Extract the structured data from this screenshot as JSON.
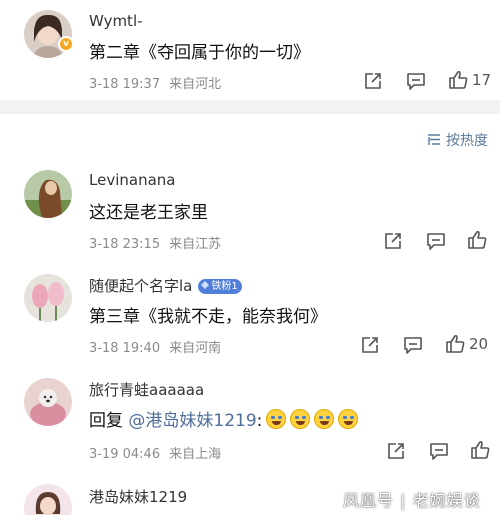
{
  "top_comment": {
    "username": "Wymtl-",
    "text": "第二章《夺回属于你的一切》",
    "date": "3-18 19:37",
    "location": "来自河北",
    "likes": "17",
    "verified_badge": "v"
  },
  "sort": {
    "icon": "sort-icon",
    "label": "按热度"
  },
  "comments": [
    {
      "username": "Levinanana",
      "text": "这还是老王家里",
      "date": "3-18 23:15",
      "location": "来自江苏",
      "likes": ""
    },
    {
      "username": "随便起个名字la",
      "fan_badge": "铁粉1",
      "text": "第三章《我就不走，能奈我何》",
      "date": "3-18 19:40",
      "location": "来自河南",
      "likes": "20"
    },
    {
      "username": "旅行青蛙aaaaaa",
      "reply_prefix": "回复",
      "mention": "@港岛妹妹1219",
      "text_suffix": ":",
      "date": "3-19 04:46",
      "location": "来自上海",
      "likes": ""
    },
    {
      "username": "港岛妹妹1219"
    }
  ],
  "watermark": "凤凰号 | 老婉娱谈",
  "colors": {
    "accent_link": "#4e6e9a",
    "meta_gray": "#8a8a8a",
    "divider": "#f2f2f2",
    "fan_badge": "#4f7fd8"
  }
}
